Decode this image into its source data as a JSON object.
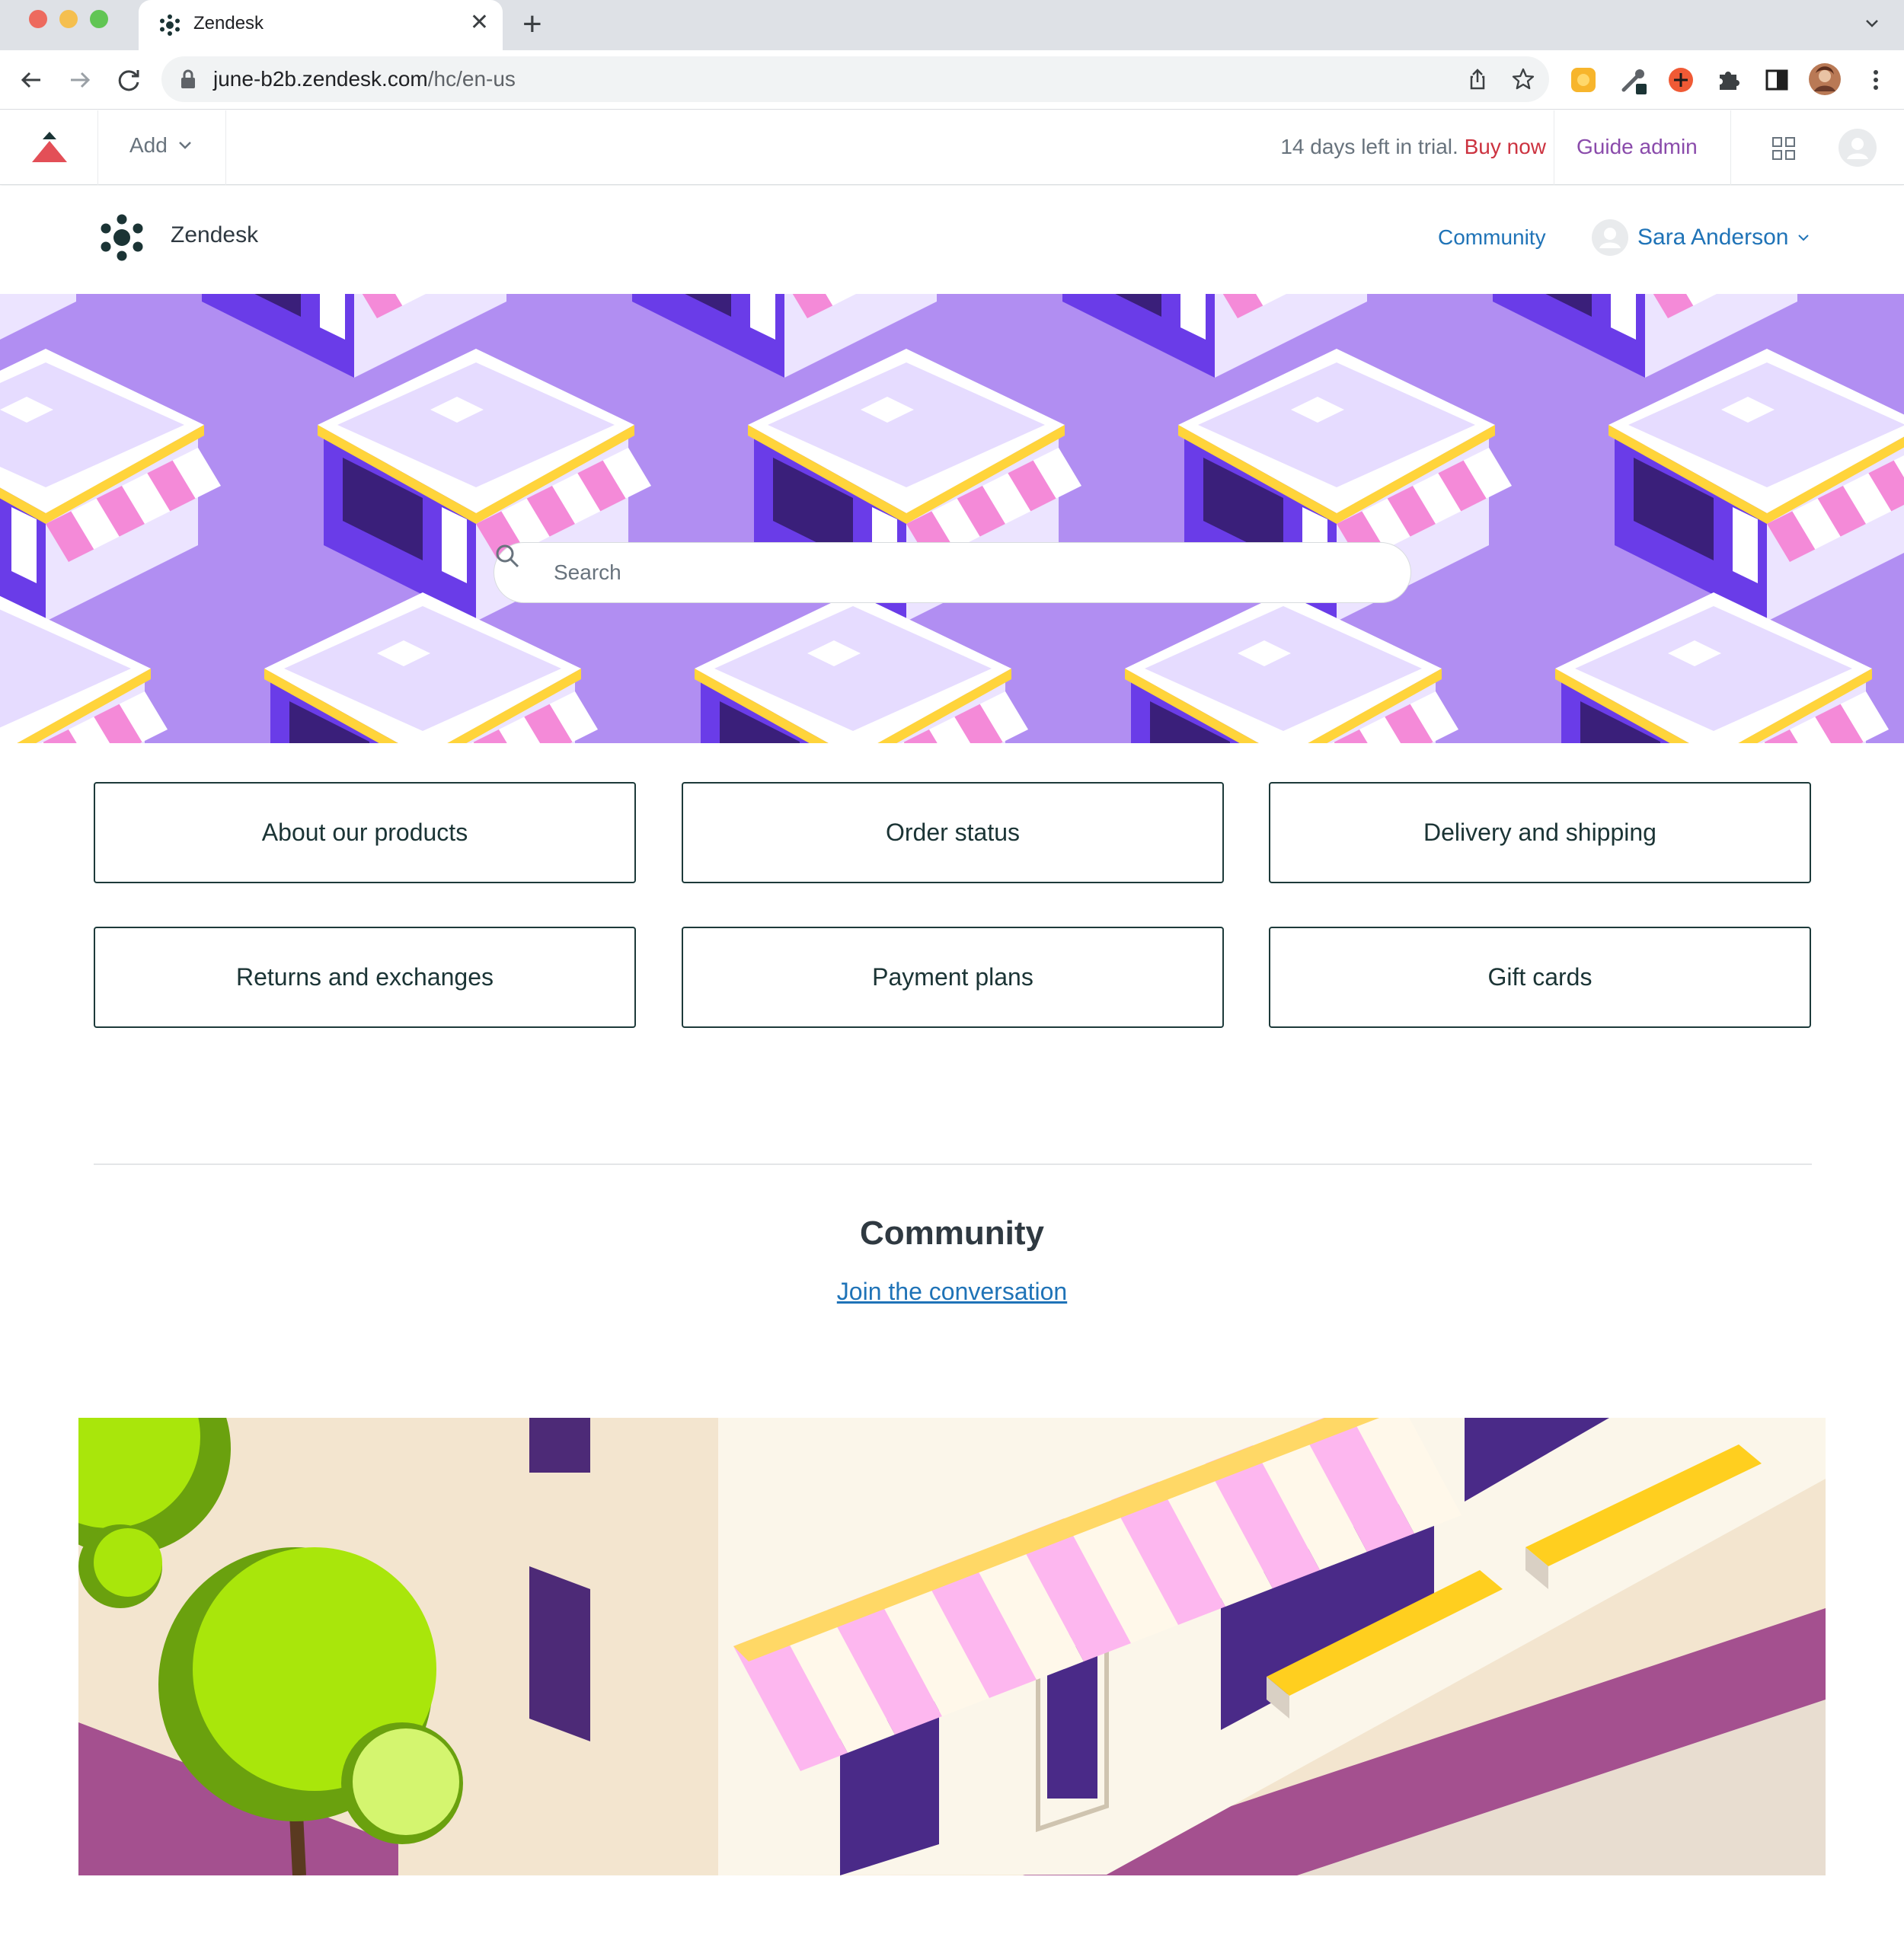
{
  "browser": {
    "tab_title": "Zendesk",
    "new_tab_symbol": "+",
    "close_symbol": "✕",
    "url_host": "june-b2b.zendesk.com",
    "url_path": "/hc/en-us"
  },
  "adminbar": {
    "add_label": "Add",
    "trial_text": "14 days left in trial.",
    "buy_now": "Buy now",
    "guide_admin": "Guide admin"
  },
  "header": {
    "brand_name": "Zendesk",
    "nav_community": "Community",
    "user_name": "Sara Anderson"
  },
  "hero": {
    "search_placeholder": "Search"
  },
  "categories": [
    "About our products",
    "Order status",
    "Delivery and shipping",
    "Returns and exchanges",
    "Payment plans",
    "Gift cards"
  ],
  "community": {
    "title": "Community",
    "link_text": "Join the conversation"
  },
  "colors": {
    "brand_text": "#1b3435",
    "link": "#1f73b7",
    "buy_now": "#cc3340",
    "hero_bg": "#b18ef2",
    "building_purple": "#6a3ce8",
    "awning_pink": "#f48ad8",
    "awning_yellow": "#ffd43b"
  },
  "icons": {
    "back": "arrow-left-icon",
    "forward": "arrow-right-icon",
    "reload": "reload-icon",
    "lock": "lock-icon",
    "share": "share-icon",
    "bookmark": "star-icon",
    "extensions": "puzzle-icon",
    "sidepanel": "side-panel-icon",
    "menu": "kebab-menu-icon",
    "apps": "grid-icon",
    "search": "search-icon"
  }
}
